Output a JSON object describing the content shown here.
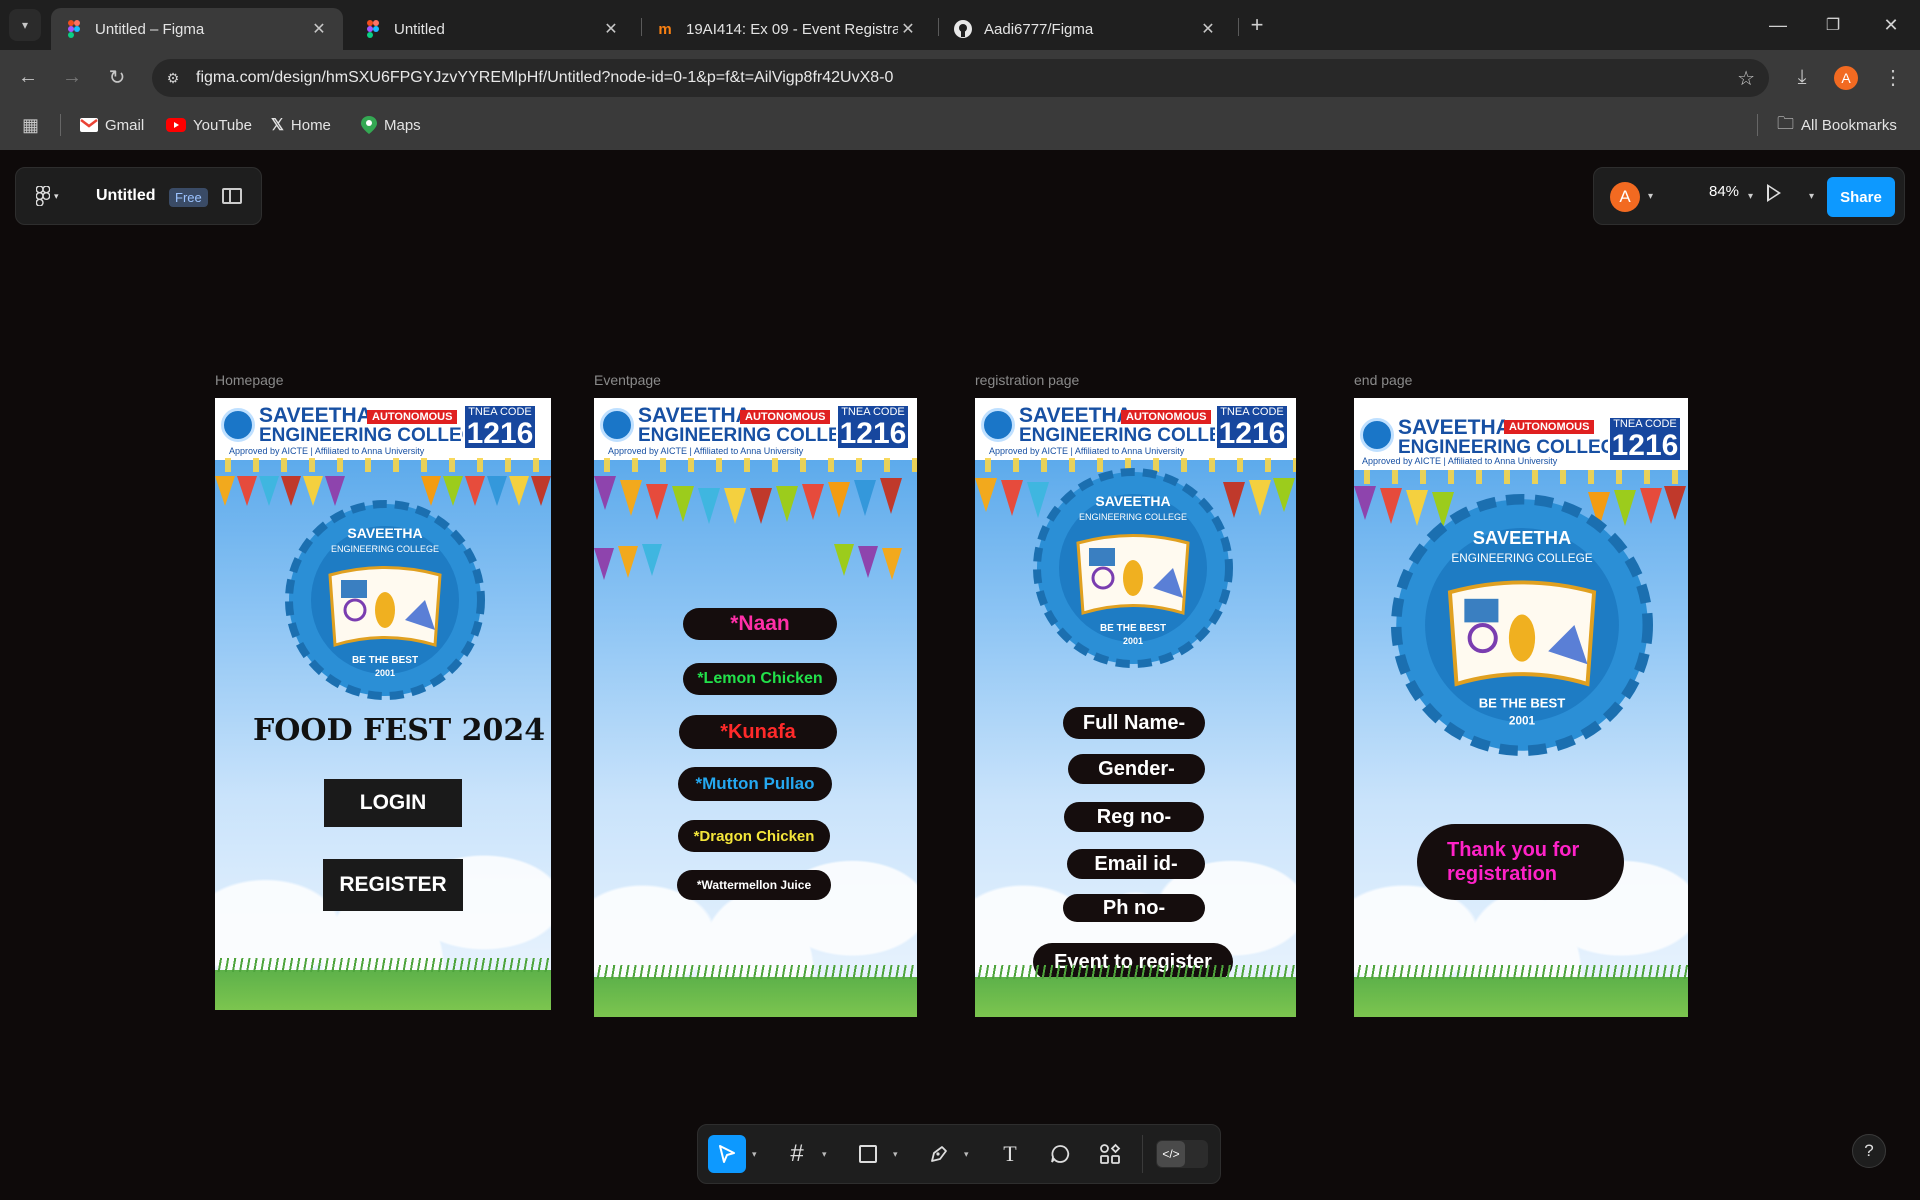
{
  "browser": {
    "tabs": [
      {
        "title": "Untitled – Figma",
        "active": true,
        "icon": "figma-icon"
      },
      {
        "title": "Untitled",
        "active": false,
        "icon": "figma-icon"
      },
      {
        "title": "19AI414: Ex 09 - Event Registrat",
        "active": false,
        "icon": "moodle-icon"
      },
      {
        "title": "Aadi6777/Figma",
        "active": false,
        "icon": "github-icon"
      }
    ],
    "new_tab": "+",
    "url": "figma.com/design/hmSXU6FPGYJzvYYREMlpHf/Untitled?node-id=0-1&p=f&t=AilVigp8fr42UvX8-0",
    "profile_initial": "A",
    "bookmarks": [
      {
        "label": "Gmail",
        "icon": "gmail-icon"
      },
      {
        "label": "YouTube",
        "icon": "youtube-icon"
      },
      {
        "label": "Home",
        "icon": "x-icon"
      },
      {
        "label": "Maps",
        "icon": "maps-icon"
      }
    ],
    "all_bookmarks": "All Bookmarks"
  },
  "figma": {
    "file_name": "Untitled",
    "plan_badge": "Free",
    "user_initial": "A",
    "zoom": "84%",
    "share_label": "Share",
    "help": "?",
    "frames": [
      {
        "label": "Homepage"
      },
      {
        "label": "Eventpage"
      },
      {
        "label": "registration page"
      },
      {
        "label": "end page"
      }
    ],
    "header": {
      "line1": "SAVEETHA",
      "line2": "ENGINEERING COLLEGE",
      "autonomous": "AUTONOMOUS",
      "sub": "Approved by AICTE | Affiliated to Anna University",
      "code_label": "TNEA CODE",
      "code": "1216"
    },
    "emblem": {
      "line1": "SAVEETHA",
      "line2": "ENGINEERING COLLEGE",
      "motto": "BE THE BEST",
      "year": "2001"
    },
    "homepage": {
      "title": "FOOD FEST 2024",
      "login": "LOGIN",
      "register": "REGISTER"
    },
    "eventpage": {
      "items": [
        {
          "text": "*Naan",
          "color": "#ff2fa8"
        },
        {
          "text": "*Lemon Chicken",
          "color": "#22e04a"
        },
        {
          "text": "*Kunafa",
          "color": "#ff2a2a"
        },
        {
          "text": "*Mutton Pullao",
          "color": "#25a8f0"
        },
        {
          "text": "*Dragon Chicken",
          "color": "#f4e63a"
        },
        {
          "text": "*Wattermellon Juice",
          "color": "#ffffff"
        }
      ]
    },
    "registration": {
      "fields": [
        "Full Name-",
        "Gender-",
        "Reg no-",
        "Email id-",
        "Ph no-"
      ],
      "event_button": "Event to register"
    },
    "endpage": {
      "message": "Thank you for registration"
    }
  }
}
